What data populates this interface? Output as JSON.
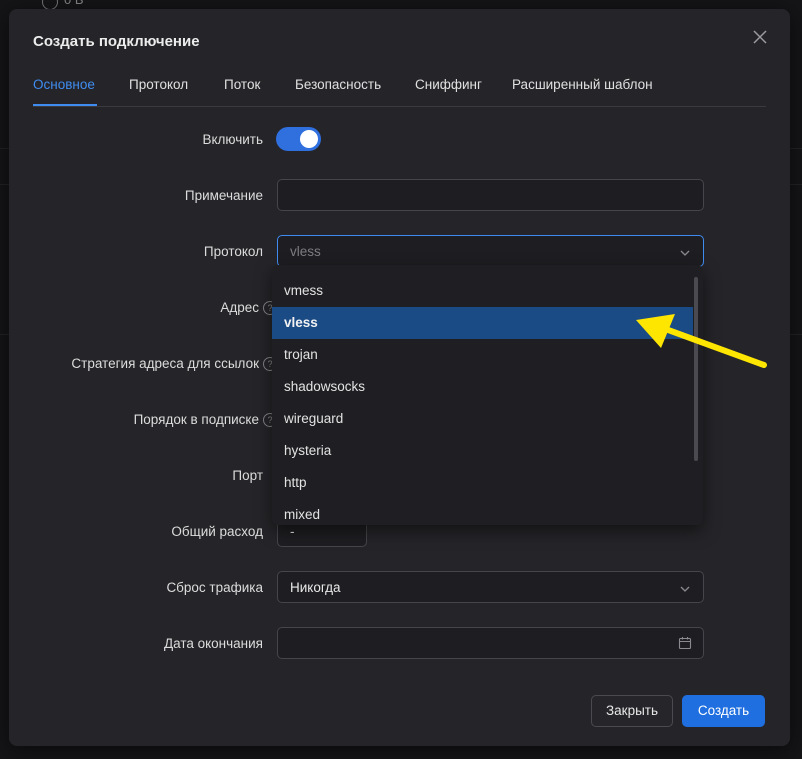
{
  "background": {
    "header_fragment": "0 В"
  },
  "modal": {
    "title": "Создать подключение",
    "tabs": [
      {
        "label": "Основное",
        "active": true
      },
      {
        "label": "Протокол"
      },
      {
        "label": "Поток"
      },
      {
        "label": "Безопасность"
      },
      {
        "label": "Сниффинг"
      },
      {
        "label": "Расширенный шаблон"
      }
    ],
    "fields": {
      "enable": {
        "label": "Включить",
        "checked": true
      },
      "remark": {
        "label": "Примечание",
        "value": ""
      },
      "protocol": {
        "label": "Протокол",
        "value": "vless"
      },
      "address": {
        "label": "Адрес"
      },
      "link_strategy": {
        "label": "Стратегия адреса для ссылок"
      },
      "sub_order": {
        "label": "Порядок в подписке"
      },
      "port": {
        "label": "Порт"
      },
      "total_traffic": {
        "label": "Общий расход",
        "value": "-"
      },
      "traffic_reset": {
        "label": "Сброс трафика",
        "value": "Никогда"
      },
      "expiry": {
        "label": "Дата окончания",
        "value": ""
      }
    },
    "protocol_options": [
      "vmess",
      "vless",
      "trojan",
      "shadowsocks",
      "wireguard",
      "hysteria",
      "http",
      "mixed"
    ],
    "selected_option": "vless",
    "help_glyph": "?",
    "buttons": {
      "close": "Закрыть",
      "create": "Создать"
    }
  },
  "colors": {
    "accent": "#3f8cf0",
    "primary_button": "#1f6fe0",
    "selected_option": "#1b4b85",
    "annotation_arrow": "#ffe600"
  },
  "icons": [
    "close-icon",
    "chevron-down-icon",
    "calendar-icon",
    "help-icon"
  ]
}
